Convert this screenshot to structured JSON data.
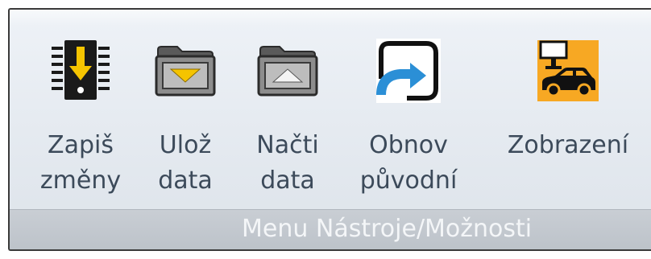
{
  "ribbon": {
    "group_title": "Menu Nástroje/Možnosti",
    "buttons": [
      {
        "line1": "Zapiš",
        "line2": "změny",
        "icon": "write-chip-icon"
      },
      {
        "line1": "Ulož",
        "line2": "data",
        "icon": "folder-save-icon"
      },
      {
        "line1": "Načti",
        "line2": "data",
        "icon": "folder-load-icon"
      },
      {
        "line1": "Obnov",
        "line2": "původní",
        "icon": "restore-icon"
      },
      {
        "line1": "Zobrazení",
        "line2": "",
        "icon": "display-car-icon"
      }
    ]
  },
  "colors": {
    "label_text": "#3c4a5a",
    "ribbon_bg": "#e6ebf1",
    "group_bar": "#c2c7cd",
    "accent_yellow": "#f5c400",
    "accent_orange": "#f7a823",
    "accent_blue": "#2b8fd6"
  }
}
